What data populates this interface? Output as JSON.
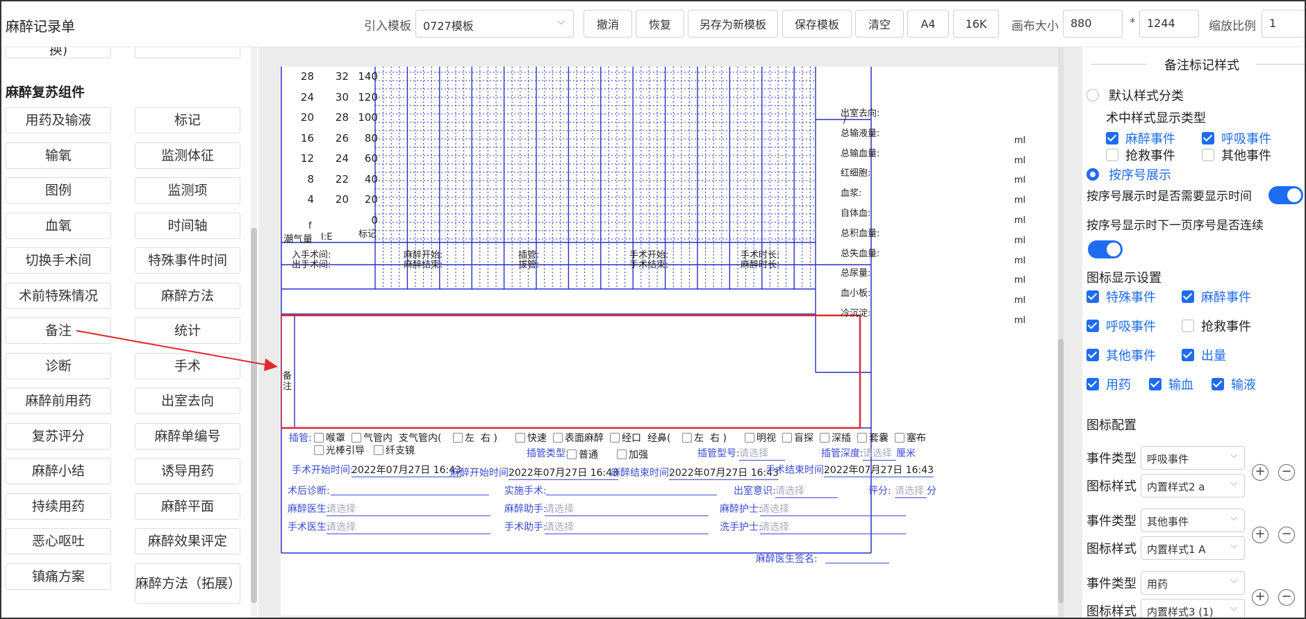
{
  "app": {
    "title": "麻醉记录单"
  },
  "toolbar": {
    "template_label": "引入模板",
    "template_value": "0727模板",
    "buttons": [
      "撤消",
      "恢复",
      "另存为新模板",
      "保存模板",
      "清空",
      "A4",
      "16K"
    ],
    "canvas_size_label": "画布大小",
    "canvas_width": "880",
    "times": "*",
    "canvas_height": "1244",
    "zoom_label": "缩放比例",
    "zoom_value": "1"
  },
  "left": {
    "top_cutoff": "换)",
    "section_title": "麻醉复苏组件",
    "components": [
      [
        "用药及输液",
        "标记"
      ],
      [
        "输氧",
        "监测体征"
      ],
      [
        "图例",
        "监测项"
      ],
      [
        "血氧",
        "时间轴"
      ],
      [
        "切换手术间",
        "特殊事件时间"
      ],
      [
        "术前特殊情况",
        "麻醉方法"
      ],
      [
        "备注",
        "统计"
      ],
      [
        "诊断",
        "手术"
      ],
      [
        "麻醉前用药",
        "出室去向"
      ],
      [
        "复苏评分",
        "麻醉单编号"
      ],
      [
        "麻醉小结",
        "诱导用药"
      ],
      [
        "持续用药",
        "麻醉平面"
      ],
      [
        "恶心呕吐",
        "麻醉效果评定"
      ],
      [
        "镇痛方案",
        "麻醉方法（拓展）"
      ]
    ]
  },
  "canvas": {
    "axis_rows": [
      {
        "a": "28",
        "b": "32",
        "c": "140"
      },
      {
        "a": "24",
        "b": "30",
        "c": "120"
      },
      {
        "a": "20",
        "b": "28",
        "c": "100"
      },
      {
        "a": "16",
        "b": "26",
        "c": "80"
      },
      {
        "a": "12",
        "b": "24",
        "c": "60"
      },
      {
        "a": "8",
        "b": "22",
        "c": "40"
      },
      {
        "a": "4",
        "b": "20",
        "c": "20"
      },
      {
        "a": "",
        "b": "",
        "c": "0"
      }
    ],
    "tidal_label": "潮气量",
    "f_label": "f",
    "ie_label": "I:E",
    "mark_label": "标记",
    "right_stats": [
      {
        "label": "出室去向:",
        "unit": "/"
      },
      {
        "label": "总输液量:",
        "unit": "ml"
      },
      {
        "label": "总输血量:",
        "unit": "ml"
      },
      {
        "label": "红细胞:",
        "unit": "ml"
      },
      {
        "label": "血浆:",
        "unit": "ml"
      },
      {
        "label": "自体血:",
        "unit": "ml"
      },
      {
        "label": "总积血量:",
        "unit": "ml"
      },
      {
        "label": "总失血量:",
        "unit": "ml"
      },
      {
        "label": "总尿量:",
        "unit": "ml"
      },
      {
        "label": "血小板:",
        "unit": "ml"
      },
      {
        "label": "冷沉淀:",
        "unit": "ml"
      }
    ],
    "times_row1": [
      "入手术间:",
      "麻醉开始:",
      "插管:",
      "手术开始:",
      "手术时长:"
    ],
    "times_row2": [
      "出手术间:",
      "麻醉结束:",
      "拔管:",
      "手术结束:",
      "麻醉时长:"
    ],
    "remark_label": "备注",
    "intubation": {
      "label": "插管:",
      "opts1": [
        "喉罩",
        "气管内",
        "支气管内(",
        "左",
        "右 )",
        "快速",
        "表面麻醉",
        "经口",
        "经鼻(",
        "左",
        "右 )",
        "明视",
        "盲探",
        "深插",
        "套囊",
        "塞布"
      ],
      "opts2": [
        "光棒引导",
        "纤支镜"
      ],
      "type_label": "插管类型:",
      "type_opts": [
        "普通",
        "加强"
      ],
      "model_label": "插管型号:",
      "model_ph": "请选择",
      "depth_label": "插管深度:",
      "depth_ph": "请选择",
      "depth_unit": "厘米"
    },
    "times_fields": [
      {
        "label": "手术开始时间:",
        "value": "2022年07月27日 16:43"
      },
      {
        "label": "麻醉开始时间:",
        "value": "2022年07月27日 16:43"
      },
      {
        "label": "麻醉结束时间:",
        "value": "2022年07月27日 16:43"
      },
      {
        "label": "手术结束时间:",
        "value": "2022年07月27日 16:43"
      }
    ],
    "diag_label": "术后诊断:",
    "surg_label": "实施手术:",
    "consc_label": "出室意识:",
    "consc_ph": "请选择",
    "score_label": "评分:",
    "score_ph": "请选择",
    "score_unit": "分",
    "staff": [
      {
        "label": "麻醉医生:",
        "ph": "请选择"
      },
      {
        "label": "麻醉助手:",
        "ph": "请选择"
      },
      {
        "label": "麻醉护士:",
        "ph": "请选择"
      },
      {
        "label": "手术医生:",
        "ph": "请选择"
      },
      {
        "label": "手术助手:",
        "ph": "请选择"
      },
      {
        "label": "洗手护士:",
        "ph": "请选择"
      }
    ],
    "sign_label": "麻醉医生签名:"
  },
  "right": {
    "title": "备注标记样式",
    "default_class": "默认样式分类",
    "intra_type_label": "术中样式显示类型",
    "intra_types": [
      {
        "label": "麻醉事件",
        "checked": true
      },
      {
        "label": "呼吸事件",
        "checked": true
      },
      {
        "label": "抢救事件",
        "checked": false
      },
      {
        "label": "其他事件",
        "checked": false
      }
    ],
    "seq_display": "按序号展示",
    "seq_time_q": "按序号展示时是否需要显示时间",
    "seq_cont_q": "按序号显示时下一页序号是否连续",
    "icon_display_title": "图标显示设置",
    "icon_display": [
      {
        "label": "特殊事件",
        "checked": true
      },
      {
        "label": "麻醉事件",
        "checked": true
      },
      {
        "label": "呼吸事件",
        "checked": true
      },
      {
        "label": "抢救事件",
        "checked": false
      },
      {
        "label": "其他事件",
        "checked": true
      },
      {
        "label": "出量",
        "checked": true
      },
      {
        "label": "用药",
        "checked": true
      },
      {
        "label": "输血",
        "checked": true
      },
      {
        "label": "输液",
        "checked": true
      }
    ],
    "icon_config_title": "图标配置",
    "event_type_label": "事件类型",
    "icon_style_label": "图标样式",
    "configs": [
      {
        "event": "呼吸事件",
        "style": "内置样式2 a"
      },
      {
        "event": "其他事件",
        "style": "内置样式1 A"
      },
      {
        "event": "用药",
        "style": "内置样式3 (1)"
      }
    ],
    "plus": "+",
    "minus": "−"
  },
  "colors": {
    "accent": "#1e6cf0",
    "form_blue": "#2630c8",
    "highlight": "#e0282f"
  }
}
